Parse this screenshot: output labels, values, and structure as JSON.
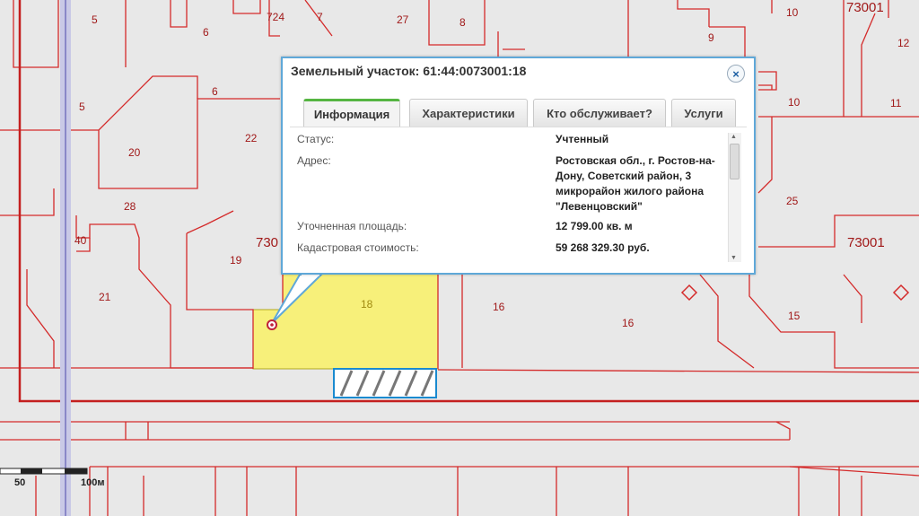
{
  "map": {
    "plot_numbers": [
      "5",
      "6",
      "724",
      "7",
      "27",
      "8",
      "9",
      "10",
      "73001",
      "12",
      "5",
      "6",
      "10",
      "11",
      "20",
      "22",
      "28",
      "25",
      "40",
      "730",
      "19",
      "73001",
      "21",
      "18",
      "16",
      "16",
      "15"
    ],
    "scale": {
      "label_50": "50",
      "label_100": "100м"
    }
  },
  "popup": {
    "title": "Земельный участок: 61:44:0073001:18",
    "close_symbol": "×",
    "tabs": [
      {
        "label": "Информация",
        "active": true
      },
      {
        "label": "Характеристики",
        "active": false
      },
      {
        "label": "Кто обслуживает?",
        "active": false
      },
      {
        "label": "Услуги",
        "active": false
      }
    ],
    "info": {
      "status_label": "Статус:",
      "status_value": "Учтенный",
      "address_label": "Адрес:",
      "address_value": "Ростовская обл., г. Ростов-на-Дону, Советский район, 3 микрорайон жилого района \"Левенцовский\"",
      "area_label": "Уточненная площадь:",
      "area_value": "12 799.00 кв. м",
      "cost_label": "Кадастровая стоимость:",
      "cost_value": "59 268 329.30 руб."
    }
  },
  "colors": {
    "boundary": "#d42a2a",
    "selected_fill": "#f7f07a",
    "popup_border": "#5fa8d8",
    "active_tab_accent": "#55b542"
  }
}
